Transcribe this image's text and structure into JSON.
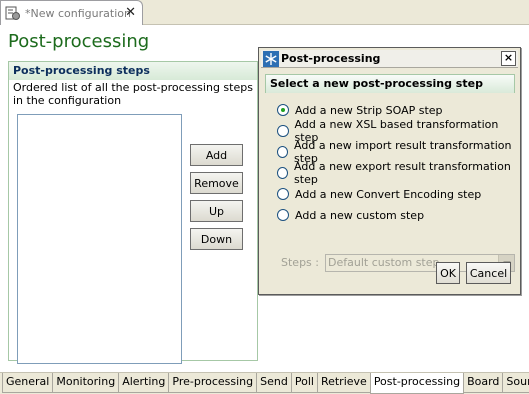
{
  "editor": {
    "tab_title": "*New configuration",
    "icons": {
      "doc": "configuration-icon",
      "close": "close-icon"
    }
  },
  "page": {
    "title": "Post-processing",
    "section_header": "Post-processing steps",
    "section_desc": "Ordered list of all the post-processing steps in the configuration",
    "buttons": {
      "add": "Add",
      "remove": "Remove",
      "up": "Up",
      "down": "Down"
    }
  },
  "bottom_tabs": [
    "General",
    "Monitoring",
    "Alerting",
    "Pre-processing",
    "Send",
    "Poll",
    "Retrieve",
    "Post-processing",
    "Board",
    "Source"
  ],
  "active_tab": "Post-processing",
  "dialog": {
    "title": "Post-processing",
    "header": "Select a new post-processing step",
    "options": [
      {
        "label": "Add a new Strip SOAP step",
        "checked": true
      },
      {
        "label": "Add a new XSL based transformation step",
        "checked": false
      },
      {
        "label": "Add a new import result transformation step",
        "checked": false
      },
      {
        "label": "Add a new export result transformation step",
        "checked": false
      },
      {
        "label": "Add a new Convert Encoding step",
        "checked": false
      },
      {
        "label": "Add a new custom step",
        "checked": false
      }
    ],
    "steps_label": "Steps :",
    "steps_value": "Default custom step",
    "ok": "OK",
    "cancel": "Cancel",
    "close_glyph": "×"
  },
  "colors": {
    "title_green": "#1d6b1d",
    "radio_dot": "#21a121"
  }
}
